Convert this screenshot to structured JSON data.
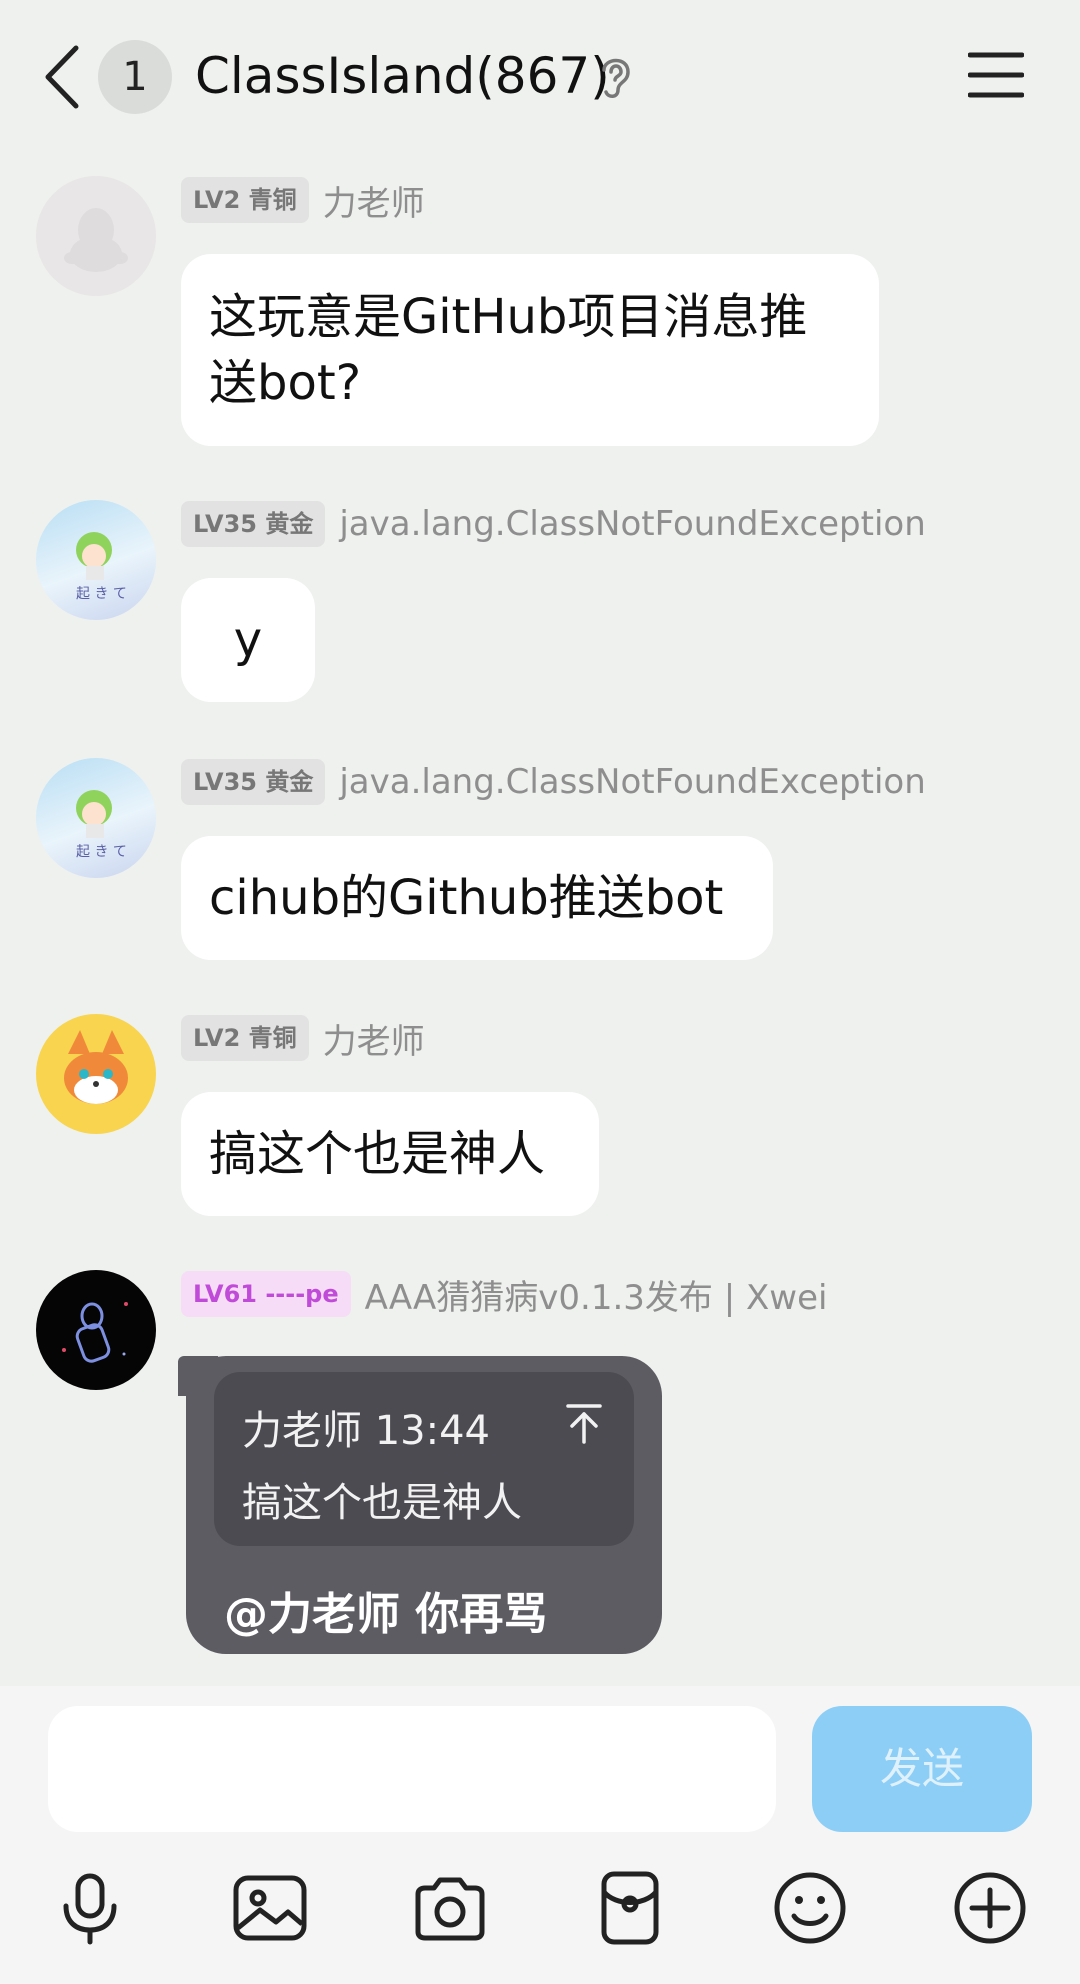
{
  "header": {
    "unread_count": "1",
    "title": "ClassIsland(867)"
  },
  "messages": [
    {
      "level": "LV2 青铜",
      "nickname": "力老师",
      "text_line1": "这玩意是GitHub项目消息推",
      "text_line2": "送bot?"
    },
    {
      "level": "LV35 黄金",
      "nickname": "java.lang.ClassNotFoundException",
      "text": "y"
    },
    {
      "level": "LV35 黄金",
      "nickname": "java.lang.ClassNotFoundException",
      "text": "cihub的Github推送bot"
    },
    {
      "level": "LV2 青铜",
      "nickname": "力老师",
      "text": "搞这个也是神人"
    },
    {
      "level": "LV61 ----pe",
      "nickname": "AAA猜猜病v0.1.3发布 | Xwei",
      "quote_header": "力老师 13:44",
      "quote_text": "搞这个也是神人",
      "text": "@力老师 你再骂"
    }
  ],
  "composer": {
    "input_value": "",
    "send_label": "发送"
  },
  "toolbar_icons": [
    "microphone-icon",
    "image-icon",
    "camera-icon",
    "red-packet-icon",
    "emoji-icon",
    "plus-icon"
  ],
  "colors": {
    "background": "#eef1ee",
    "send_button": "#8dcef6",
    "reply_bubble": "#5e5c63",
    "level_purple": "#c04bd8"
  }
}
